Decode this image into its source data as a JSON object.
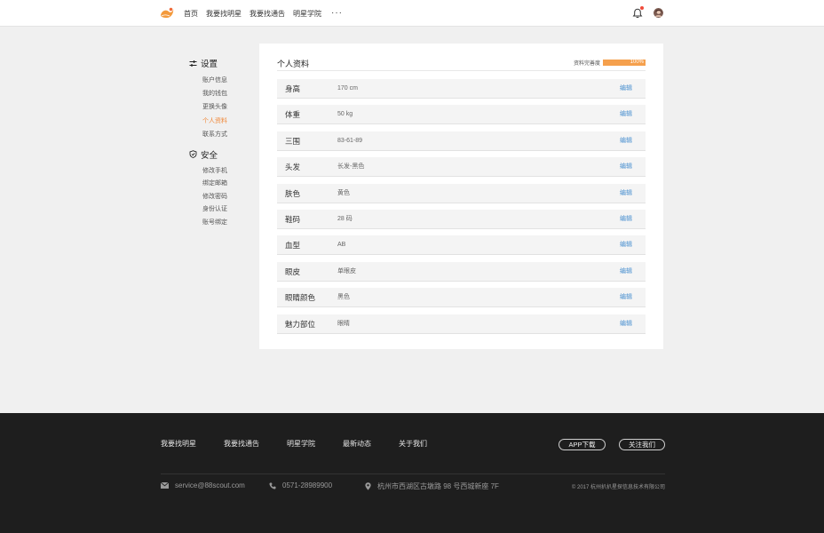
{
  "header": {
    "nav": [
      "首页",
      "我要找明星",
      "我要找通告",
      "明星学院"
    ],
    "more": "···"
  },
  "sidebar": {
    "settings_title": "设置",
    "settings_items": [
      "账户信息",
      "我的钱包",
      "更换头像",
      "个人资料",
      "联系方式"
    ],
    "active_item": "个人资料",
    "security_title": "安全",
    "security_items": [
      "修改手机",
      "绑定邮箱",
      "修改密码",
      "身份认证",
      "账号绑定"
    ]
  },
  "main": {
    "title": "个人资料",
    "completion_label": "资料完善度",
    "completion_percent": 100,
    "completion_text": "100%",
    "edit_label": "编辑",
    "rows": [
      {
        "label": "身高",
        "value": "170 cm"
      },
      {
        "label": "体重",
        "value": "50 kg"
      },
      {
        "label": "三围",
        "value": "83-61-89"
      },
      {
        "label": "头发",
        "value": "长发-黑色"
      },
      {
        "label": "肤色",
        "value": "黄色"
      },
      {
        "label": "鞋码",
        "value": "28 码"
      },
      {
        "label": "血型",
        "value": "AB"
      },
      {
        "label": "眼皮",
        "value": "单眼皮"
      },
      {
        "label": "眼睛颜色",
        "value": "黑色"
      },
      {
        "label": "魅力部位",
        "value": "眼睛"
      }
    ]
  },
  "footer": {
    "links": [
      "我要找明星",
      "我要找通告",
      "明星学院",
      "最新动态",
      "关于我们"
    ],
    "app_button": "APP下载",
    "follow_button": "关注我们",
    "email": "service@88scout.com",
    "phone": "0571-28989900",
    "address": "杭州市西湖区古墩路 98 号西城新座 7F",
    "copyright": "© 2017 杭州扒扒星探信息技术有限公司"
  },
  "colors": {
    "accent": "#f0883a",
    "progress": "#f5a04d",
    "link": "#4a90d0",
    "footer_bg": "#1e1e1e"
  }
}
